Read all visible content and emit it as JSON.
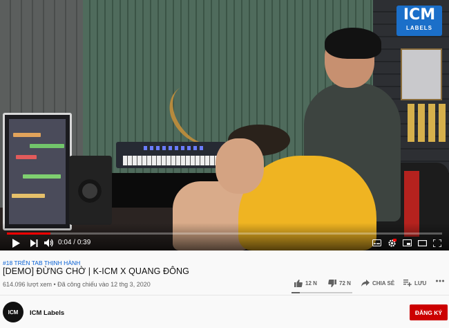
{
  "video": {
    "logo": {
      "text": "ICM",
      "subtext": "LABELS"
    },
    "progress_fraction": 0.1,
    "time_current": "0:04",
    "time_separator": "/",
    "time_total": "0:39",
    "controls": [
      "play-icon",
      "next-icon",
      "volume-icon",
      "subtitles-icon",
      "settings-icon",
      "miniplayer-icon",
      "theater-icon",
      "fullscreen-icon"
    ]
  },
  "info": {
    "hashtag": "#18 TRÊN TAB THỊNH HÀNH",
    "title": "[DEMO] ĐỪNG CHỜ | K-ICM X QUANG ĐÔNG",
    "meta": "614.096 lượt xem • Đã công chiếu vào 12 thg 3, 2020",
    "likes": "12 N",
    "dislikes": "72 N",
    "share": "CHIA SẺ",
    "save": "LƯU",
    "like_ratio": 0.14
  },
  "channel": {
    "name": "ICM Labels",
    "avatar_text": "ICM",
    "subscribe": "ĐĂNG KÝ"
  },
  "colors": {
    "accent": "#cc0000",
    "link": "#065fd4",
    "progress": "#ff0000"
  }
}
